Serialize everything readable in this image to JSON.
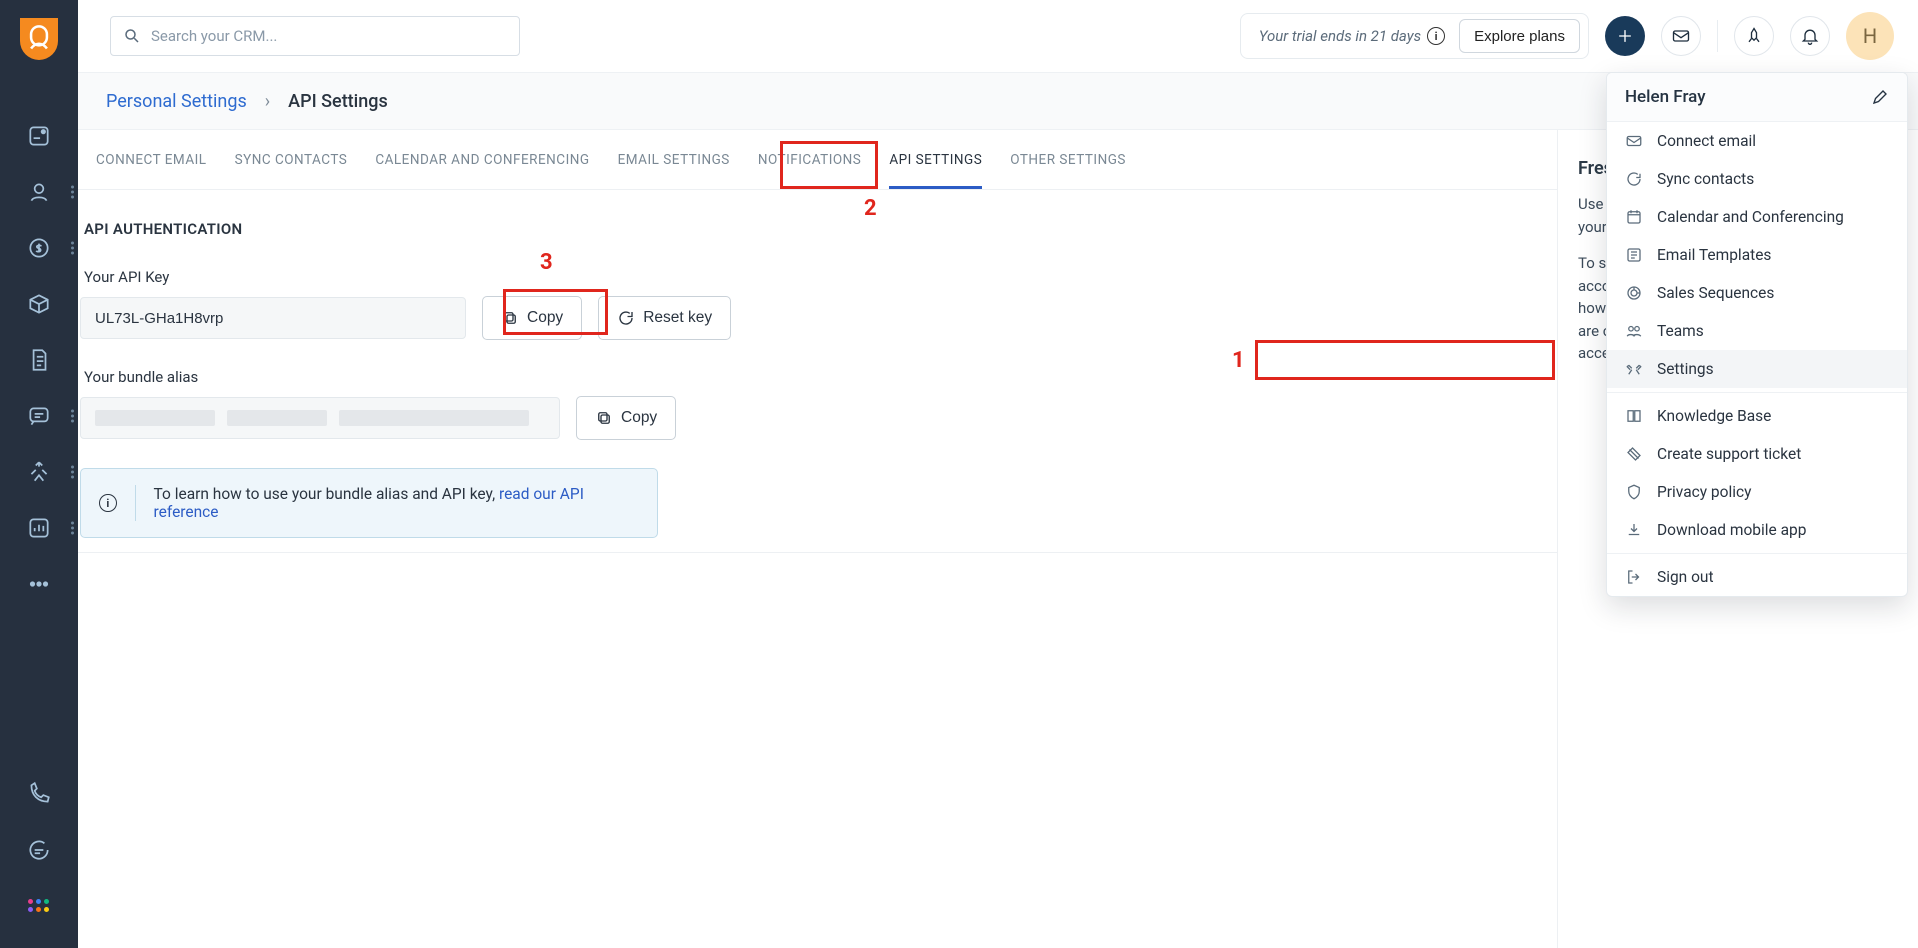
{
  "search": {
    "placeholder": "Search your CRM..."
  },
  "header": {
    "trial_text": "Your trial ends in 21 days",
    "explore_label": "Explore plans",
    "avatar_initial": "H"
  },
  "breadcrumb": {
    "root": "Personal Settings",
    "current": "API Settings"
  },
  "tabs": [
    "CONNECT  EMAIL",
    "SYNC  CONTACTS",
    "CALENDAR  AND  CONFERENCING",
    "EMAIL  SETTINGS",
    "NOTIFICATIONS",
    "API  SETTINGS",
    "OTHER  SETTINGS"
  ],
  "active_tab_index": 5,
  "api": {
    "section_title": "API AUTHENTICATION",
    "key_label": "Your API Key",
    "key_value": "UL73L-GHa1H8vrp",
    "copy_label": "Copy",
    "reset_label": "Reset key",
    "alias_label": "Your bundle alias",
    "alias_copy_label": "Copy",
    "banner_text": "To learn how to use your bundle alias and API key, ",
    "banner_link": "read our API reference"
  },
  "right_panel": {
    "title": "Fres",
    "p1": "Use your",
    "p2_a": "To st",
    "p2_b": "accou",
    "p2_c": "howe",
    "p2_d": "are c",
    "p2_e": "acces"
  },
  "user_menu": {
    "name": "Helen Fray",
    "items_top": [
      "Connect email",
      "Sync contacts",
      "Calendar and Conferencing",
      "Email Templates",
      "Sales Sequences",
      "Teams",
      "Settings"
    ],
    "items_bottom": [
      "Knowledge Base",
      "Create support ticket",
      "Privacy policy",
      "Download mobile app"
    ],
    "signout": "Sign out"
  },
  "annotations": {
    "n1": "1",
    "n2": "2",
    "n3": "3"
  }
}
